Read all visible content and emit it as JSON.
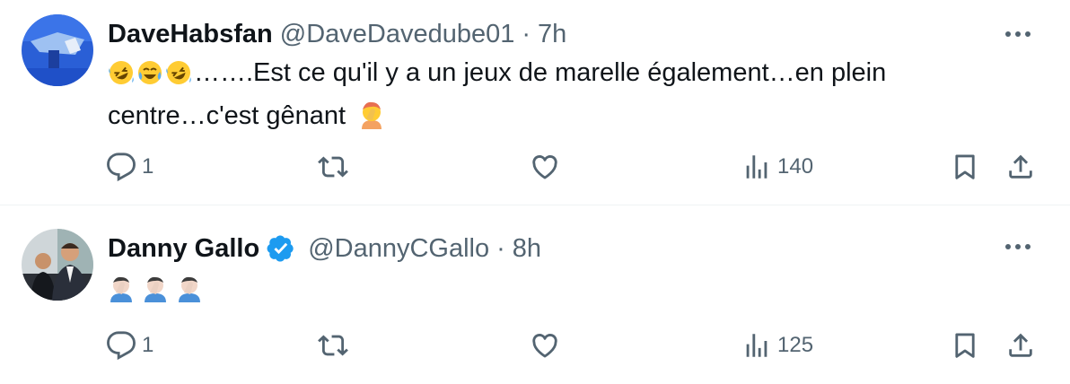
{
  "tweets": [
    {
      "display_name": "DaveHabsfan",
      "handle": "@DaveDavedube01",
      "separator": "·",
      "time": "7h",
      "text": "…….Est ce qu'il y a un jeux de marelle également…en plein centre…c'est gênant",
      "leading_emojis": [
        "rofl-emoji",
        "joy-emoji",
        "rofl-emoji"
      ],
      "trailing_emoji": "facepalm-emoji",
      "verified": false,
      "replies": "1",
      "reposts": "",
      "likes": "",
      "views": "140"
    },
    {
      "display_name": "Danny Gallo",
      "handle": "@DannyCGallo",
      "separator": "·",
      "time": "8h",
      "text": "",
      "leading_emojis": [
        "facepalm-man-emoji",
        "facepalm-man-emoji",
        "facepalm-man-emoji"
      ],
      "verified": true,
      "replies": "1",
      "reposts": "",
      "likes": "",
      "views": "125"
    }
  ],
  "colors": {
    "text": "#0f1419",
    "secondary": "#536471",
    "divider": "#eff3f4",
    "verified": "#1d9bf0"
  }
}
